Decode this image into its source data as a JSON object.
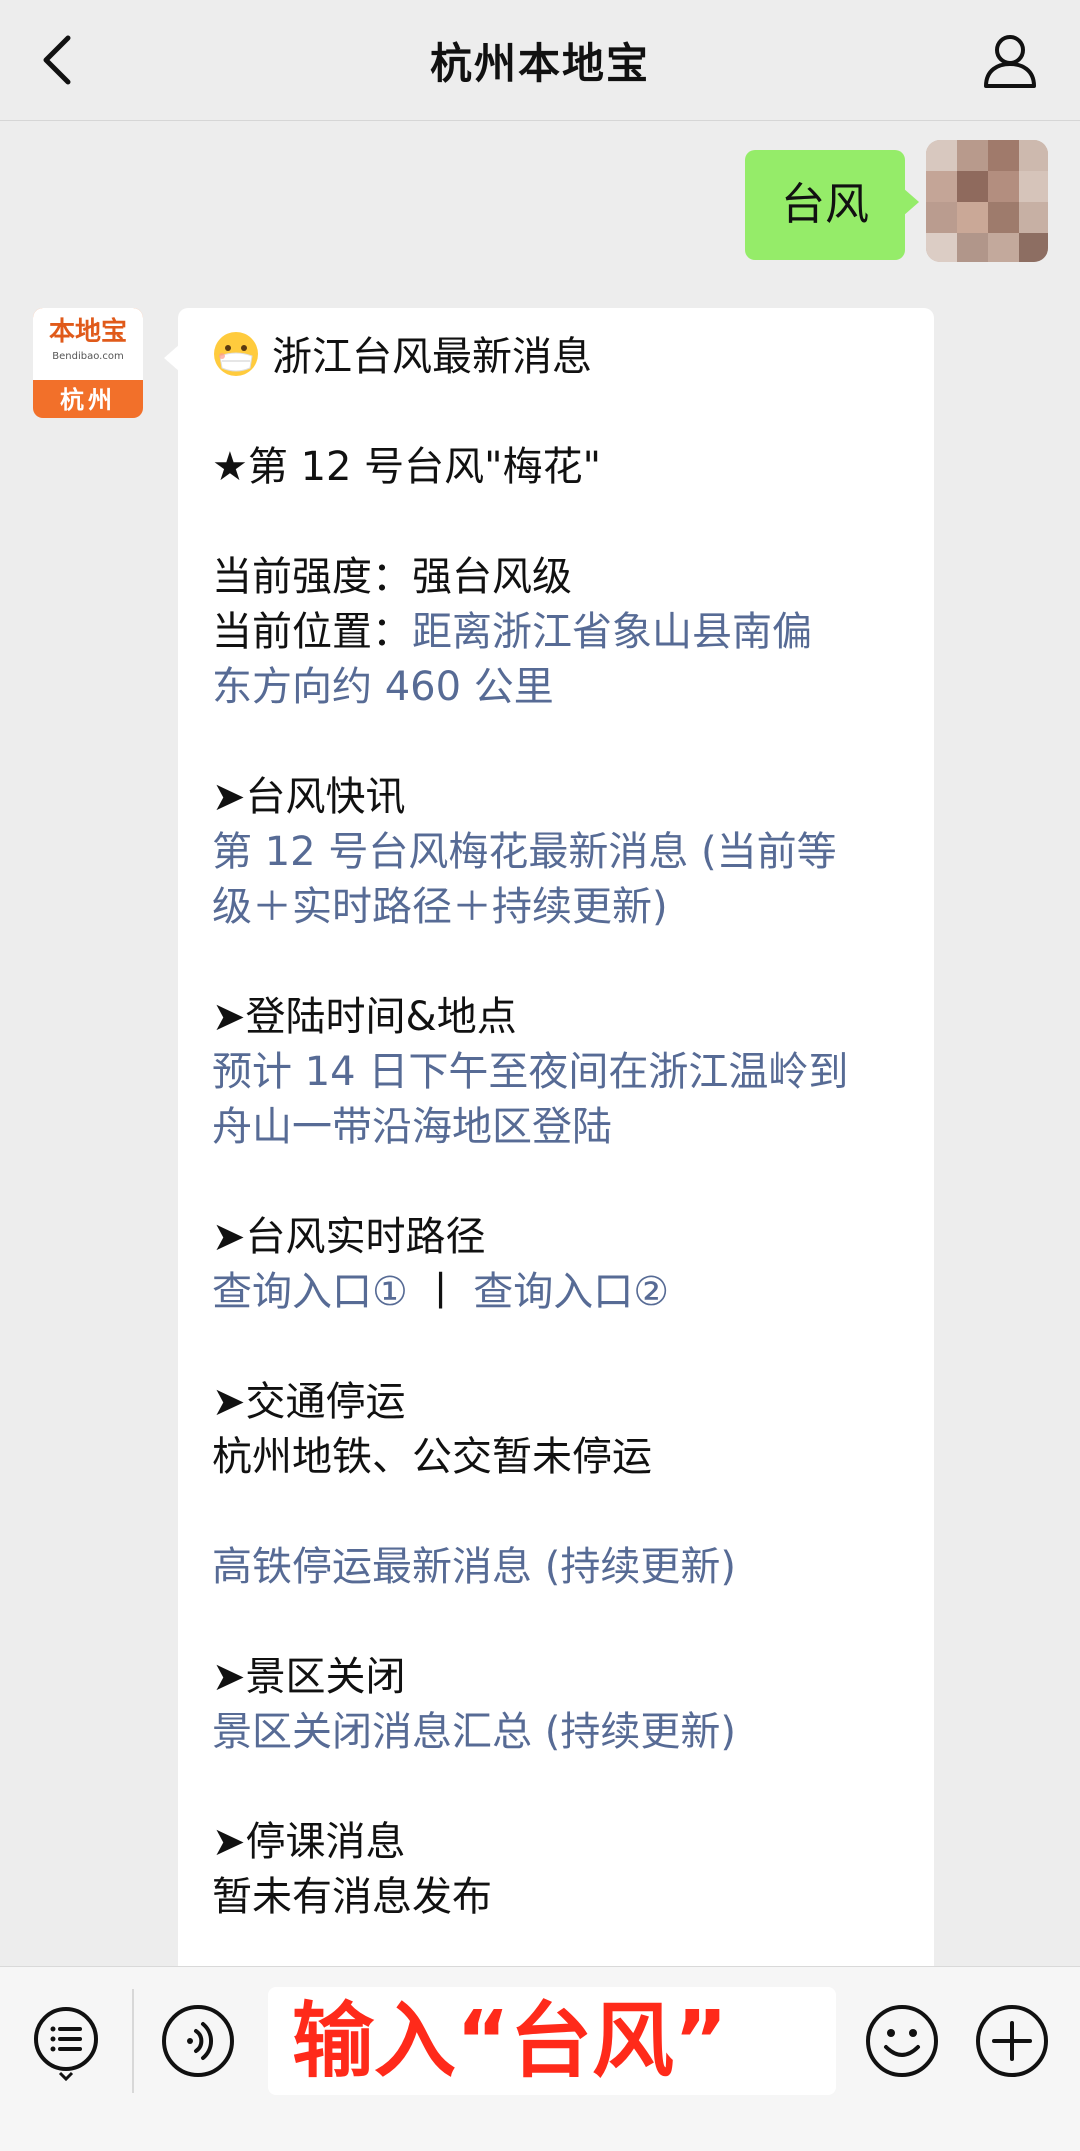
{
  "header": {
    "title": "杭州本地宝",
    "back_icon": "chevron-left-icon",
    "profile_icon": "person-icon"
  },
  "outgoing": {
    "text": "台风",
    "bubble_color": "#95ec69"
  },
  "bot": {
    "logo_text": "本地宝",
    "logo_domain": "Bendibao.com",
    "logo_city": "杭州",
    "accent_color": "#f2702a"
  },
  "message": {
    "heading": "浙江台风最新消息",
    "typhoon_name": "★第 12 号台风\"梅花\"",
    "intensity_label": "当前强度：",
    "intensity_value": "强台风级",
    "position_label": "当前位置：",
    "position_line1": "距离浙江省象山县南偏",
    "position_line2": "东方向约 460 公里",
    "sec_news": "➤台风快讯",
    "news_link1": "第 12 号台风梅花最新消息 (当前等",
    "news_link2": "级＋实时路径＋持续更新)",
    "sec_landfall": "➤登陆时间&地点",
    "landfall_line1": "预计 14 日下午至夜间在浙江温岭到",
    "landfall_line2": "舟山一带沿海地区登陆",
    "sec_path": "➤台风实时路径",
    "path_link1": "查询入口①",
    "path_sep": "丨",
    "path_link2": "查询入口②",
    "sec_traffic": "➤交通停运",
    "traffic_text": "杭州地铁、公交暂未停运",
    "rail_link": "高铁停运最新消息 (持续更新)",
    "sec_scenic": "➤景区关闭",
    "scenic_link": "景区关闭消息汇总 (持续更新)",
    "sec_school": "➤停课消息",
    "school_text": "暂未有消息发布",
    "link_color": "#576b95"
  },
  "bottombar": {
    "menu_icon": "menu-list-icon",
    "voice_icon": "voice-icon",
    "input_value": "输入“台风”",
    "emoji_icon": "smiley-icon",
    "plus_icon": "plus-icon"
  }
}
